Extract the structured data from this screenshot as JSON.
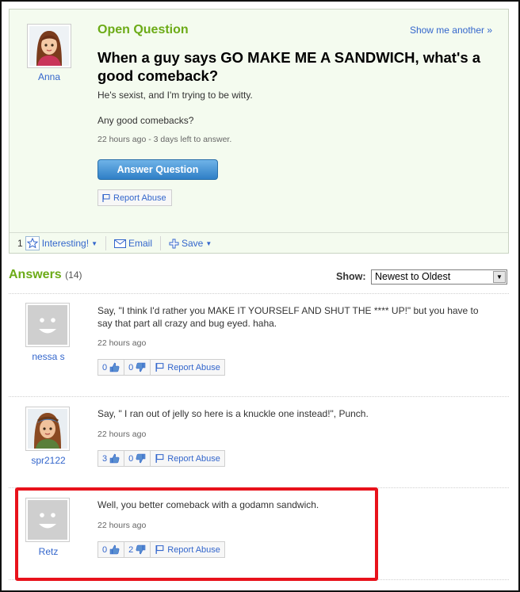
{
  "question": {
    "section_label": "Open Question",
    "show_another": "Show me another »",
    "asker": "Anna",
    "title": "When a guy says GO MAKE ME A SANDWICH, what's a good comeback?",
    "details": [
      "He's sexist, and I'm trying to be witty.",
      "Any good comebacks?"
    ],
    "meta": "22 hours ago - 3 days left to answer.",
    "answer_button": "Answer Question",
    "report_label": "Report Abuse",
    "actions": {
      "interesting_count": "1",
      "interesting_label": "Interesting!",
      "email_label": "Email",
      "save_label": "Save"
    }
  },
  "answers_header": {
    "title": "Answers",
    "count": "(14)",
    "show_label": "Show:",
    "sort_selected": "Newest to Oldest"
  },
  "answers": [
    {
      "user": "nessa s",
      "avatar": "default-avatar-icon",
      "text": "Say, \"I think I'd rather you MAKE IT YOURSELF AND SHUT THE **** UP!\" but you have to say that part all crazy and bug eyed. haha.",
      "time": "22 hours ago",
      "thumbs_up": "0",
      "thumbs_down": "0",
      "report_label": "Report Abuse"
    },
    {
      "user": "spr2122",
      "avatar": "cartoon-avatar-icon",
      "text": "Say, \" I ran out of jelly so here is a knuckle one instead!\", Punch.",
      "time": "22 hours ago",
      "thumbs_up": "3",
      "thumbs_down": "0",
      "report_label": "Report Abuse"
    },
    {
      "user": "Retz",
      "avatar": "default-avatar-icon",
      "text": "Well, you better comeback with a godamn sandwich.",
      "time": "22 hours ago",
      "thumbs_up": "0",
      "thumbs_down": "2",
      "report_label": "Report Abuse"
    }
  ],
  "colors": {
    "accent_green": "#6cab17",
    "link_blue": "#3366cc",
    "highlight_red": "#e8121b",
    "question_bg": "#f4fbef"
  }
}
